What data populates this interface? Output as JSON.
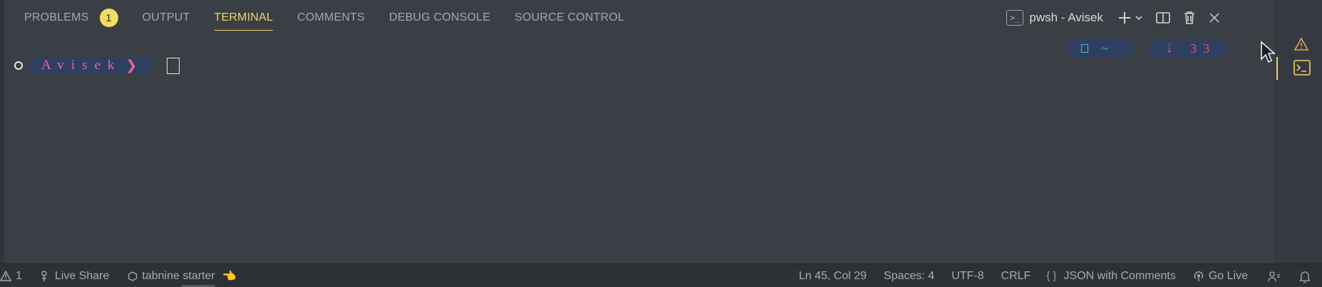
{
  "tabs": [
    {
      "label": "PROBLEMS",
      "badge": "1"
    },
    {
      "label": "OUTPUT"
    },
    {
      "label": "TERMINAL"
    },
    {
      "label": "COMMENTS"
    },
    {
      "label": "DEBUG CONSOLE"
    },
    {
      "label": "SOURCE CONTROL"
    }
  ],
  "active_tab": "TERMINAL",
  "terminal": {
    "shell_label": "pwsh - Avisek",
    "shell_icon_text": ">_",
    "prompt_user": "Avisek",
    "prompt_arrow": "❯",
    "right_prompt_1": "~",
    "right_prompt_2_arrow": "⇣",
    "right_prompt_2_value": "33"
  },
  "actions": {
    "new_terminal": "+",
    "dropdown": "⌄",
    "split": "split",
    "kill": "trash",
    "close": "×"
  },
  "statusbar": {
    "problems_count": "1",
    "live_share": "Live Share",
    "tabnine": "tabnine starter",
    "position": "Ln 45, Col 29",
    "spaces": "Spaces: 4",
    "encoding": "UTF-8",
    "eol": "CRLF",
    "language": "JSON with Comments",
    "go_live": "Go Live"
  },
  "colors": {
    "accent": "#f3d36a",
    "badge": "#f3dc60",
    "prompt_bg": "#2f3f62",
    "prompt_user": "#e86a8a",
    "rprompt_cyan": "#3cc8d8",
    "rprompt_red": "#e8564f",
    "panel_bg": "#3a3f45"
  }
}
